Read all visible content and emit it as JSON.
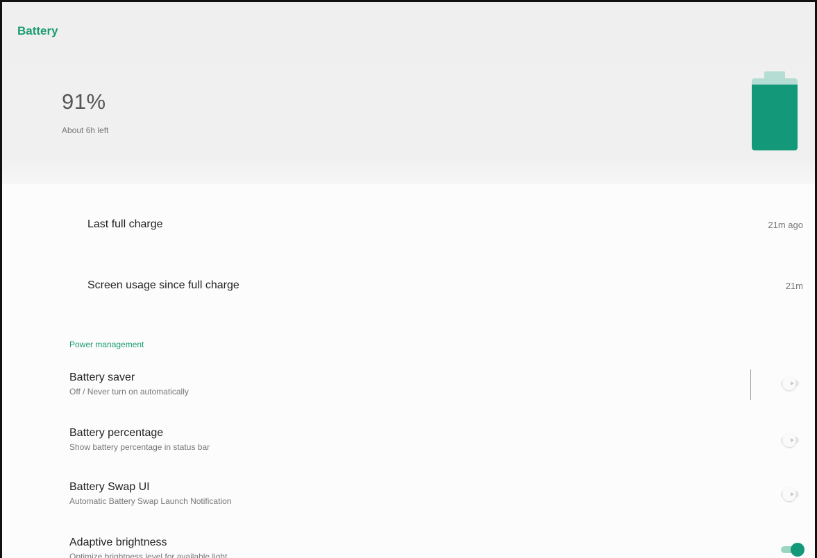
{
  "app_bar": {
    "title": "Battery"
  },
  "battery": {
    "percent_label": "91%",
    "level": 0.91,
    "time_left": "About 6h left",
    "fill_color": "#13987a",
    "empty_color": "#b6ddd3"
  },
  "usage": {
    "last_full_charge": {
      "label": "Last full charge",
      "value": "21m ago"
    },
    "screen_usage": {
      "label": "Screen usage since full charge",
      "value": "21m"
    }
  },
  "power_management": {
    "header": "Power management",
    "items": [
      {
        "title": "Battery saver",
        "summary": "Off / Never turn on automatically",
        "enabled": false
      },
      {
        "title": "Battery percentage",
        "summary": "Show battery percentage in status bar",
        "enabled": false
      },
      {
        "title": "Battery Swap UI",
        "summary": "Automatic Battery Swap Launch Notification",
        "enabled": false
      },
      {
        "title": "Adaptive brightness",
        "summary": "Optimize brightness level for available light",
        "enabled": true
      }
    ]
  },
  "colors": {
    "accent": "#1a9c70",
    "header_background": "#f0f0f0"
  }
}
